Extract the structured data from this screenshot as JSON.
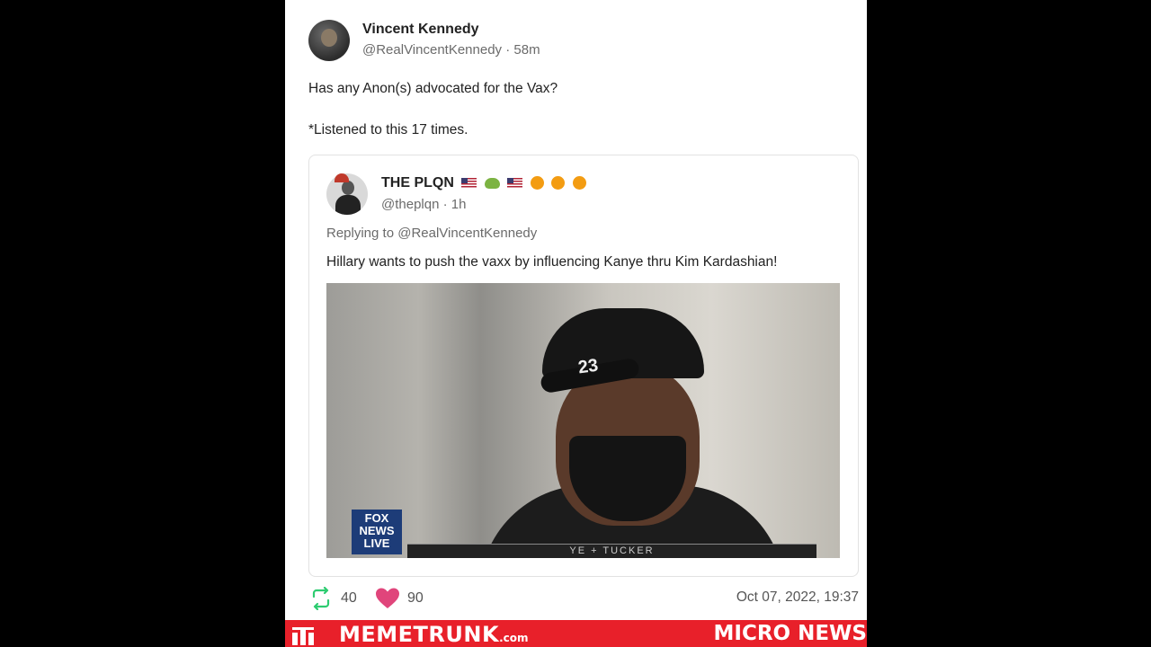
{
  "post": {
    "author_name": "Vincent Kennedy",
    "author_handle_time": "@RealVincentKennedy · 58m",
    "line1": "Has any Anon(s) advocated for the Vax?",
    "line2": "*Listened to this 17 times."
  },
  "quoted": {
    "author_name": "THE PLQN",
    "handle_time": "@theplqn · 1h",
    "replying": "Replying to @RealVincentKennedy",
    "text": "Hillary wants to push the vaxx by influencing Kanye thru Kim Kardashian!",
    "media": {
      "cap_text": "23",
      "logo_text": "FOX NEWS LIVE",
      "lower_third": "YE + TUCKER"
    }
  },
  "actions": {
    "reposts": "40",
    "likes": "90",
    "date": "Oct 07, 2022, 19:37"
  },
  "banner": {
    "site": "MEMETRUNK",
    "tld": ".com",
    "right": "MICRO NEWS"
  },
  "colors": {
    "accent_red": "#e8202a",
    "repost_green": "#2ecc71",
    "like_pink": "#e0457b"
  }
}
